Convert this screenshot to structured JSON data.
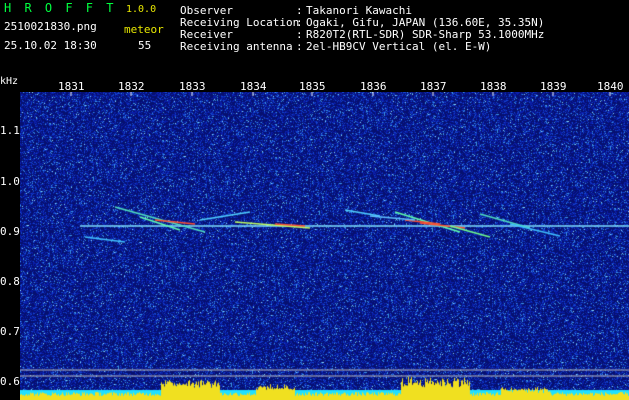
{
  "header": {
    "app_name": "H R O F F T",
    "version": "1.0.0",
    "filename": "2510021830.png",
    "timestamp": "25.10.02 18:30",
    "meteor_label": "meteor",
    "meteor_count": "55",
    "info": [
      {
        "label": "Observer",
        "sep": ":",
        "value": "Takanori Kawachi"
      },
      {
        "label": "Receiving Location",
        "sep": ":",
        "value": "Ogaki, Gifu, JAPAN (136.60E, 35.35N)"
      },
      {
        "label": "Receiver",
        "sep": ":",
        "value": "R820T2(RTL-SDR) SDR-Sharp 53.1000MHz"
      },
      {
        "label": "Receiving antenna",
        "sep": ":",
        "value": "2el-HB9CV Vertical (el. E-W)"
      }
    ]
  },
  "axis": {
    "unit": "kHz",
    "time_ticks": [
      "1831",
      "1832",
      "1833",
      "1834",
      "1835",
      "1836",
      "1837",
      "1838",
      "1839",
      "1840"
    ],
    "freq_ticks": [
      "1.1",
      "1.0",
      "0.9",
      "0.8",
      "0.7",
      "0.6"
    ]
  },
  "colors": {
    "background_noise": "#0a1a8c",
    "carrier": "#7fe0ff",
    "echo_hot": "#ff5030",
    "power_bar": "#f0e020",
    "power_base": "#20e0ff"
  }
}
